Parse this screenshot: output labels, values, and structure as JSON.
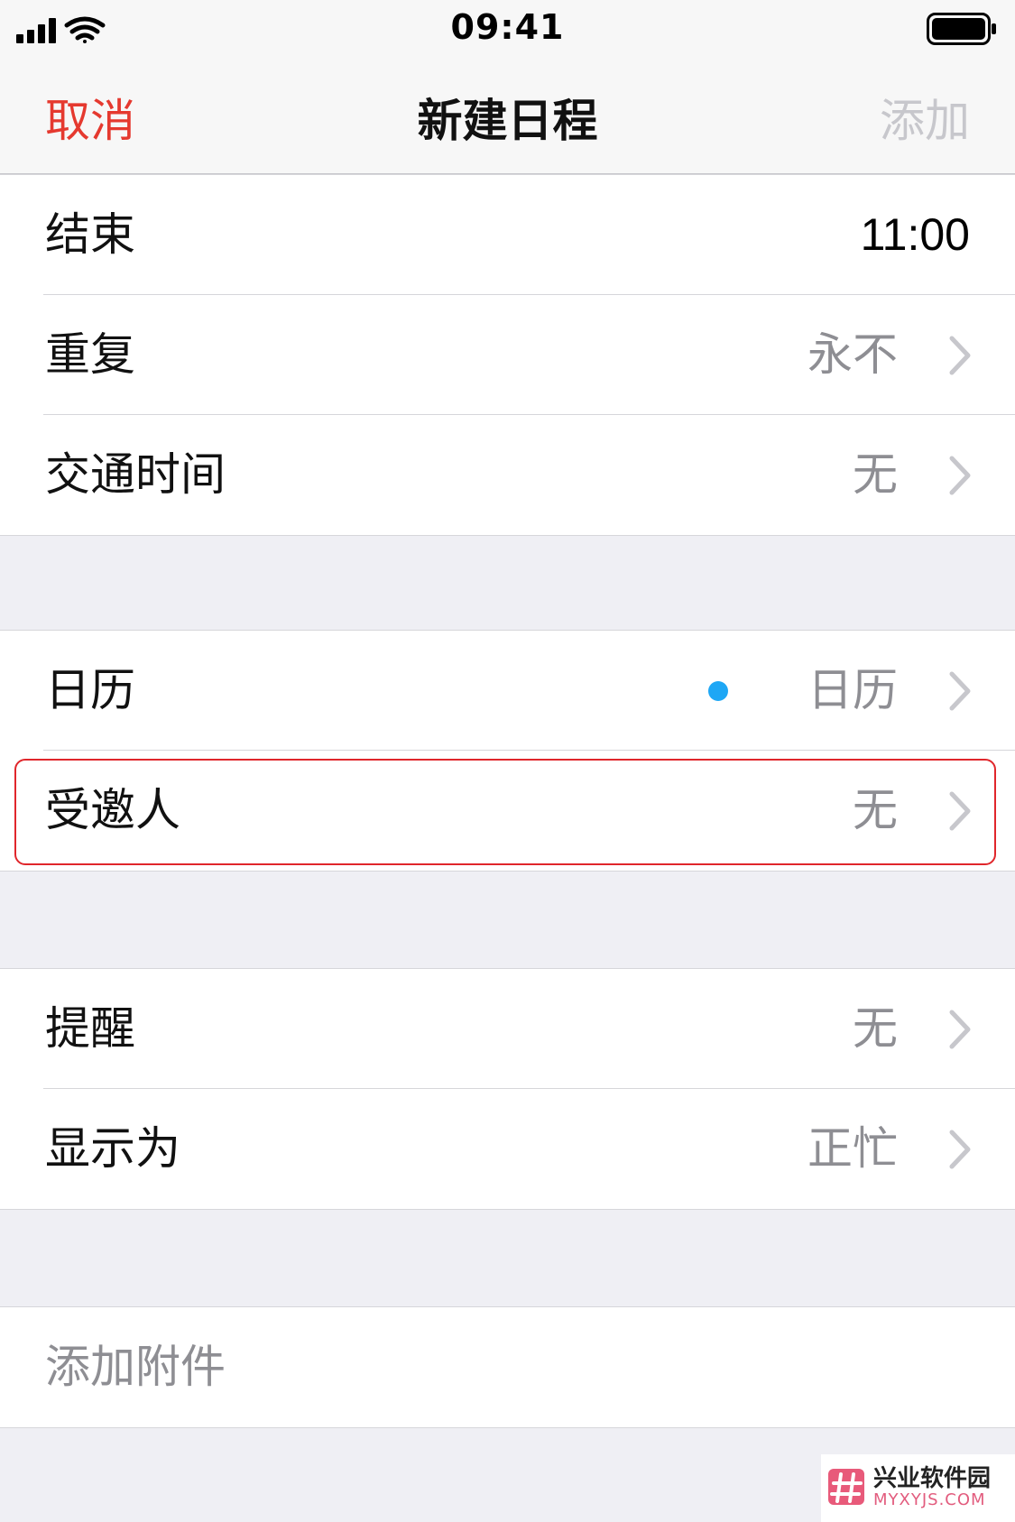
{
  "status_bar": {
    "time": "09:41",
    "signal_icon": "cellular-signal-icon",
    "wifi_icon": "wifi-icon",
    "battery_icon": "battery-full-icon"
  },
  "nav": {
    "cancel_label": "取消",
    "title": "新建日程",
    "add_label": "添加",
    "cancel_color": "#e5392f",
    "add_disabled_color": "#c7c7cc"
  },
  "group1": {
    "end": {
      "label": "结束",
      "value": "11:00"
    },
    "repeat": {
      "label": "重复",
      "value": "永不"
    },
    "travel": {
      "label": "交通时间",
      "value": "无"
    }
  },
  "group2": {
    "calendar": {
      "label": "日历",
      "value": "日历",
      "dot_color": "#1ea7f5"
    },
    "invitees": {
      "label": "受邀人",
      "value": "无"
    }
  },
  "group3": {
    "alert": {
      "label": "提醒",
      "value": "无"
    },
    "show_as": {
      "label": "显示为",
      "value": "正忙"
    }
  },
  "group4": {
    "attachment": {
      "label": "添加附件"
    }
  },
  "watermark": {
    "logo_icon": "hash-logo-icon",
    "name": "兴业软件园",
    "url": "MYXYJS.COM"
  },
  "highlight_color": "#e0262b"
}
